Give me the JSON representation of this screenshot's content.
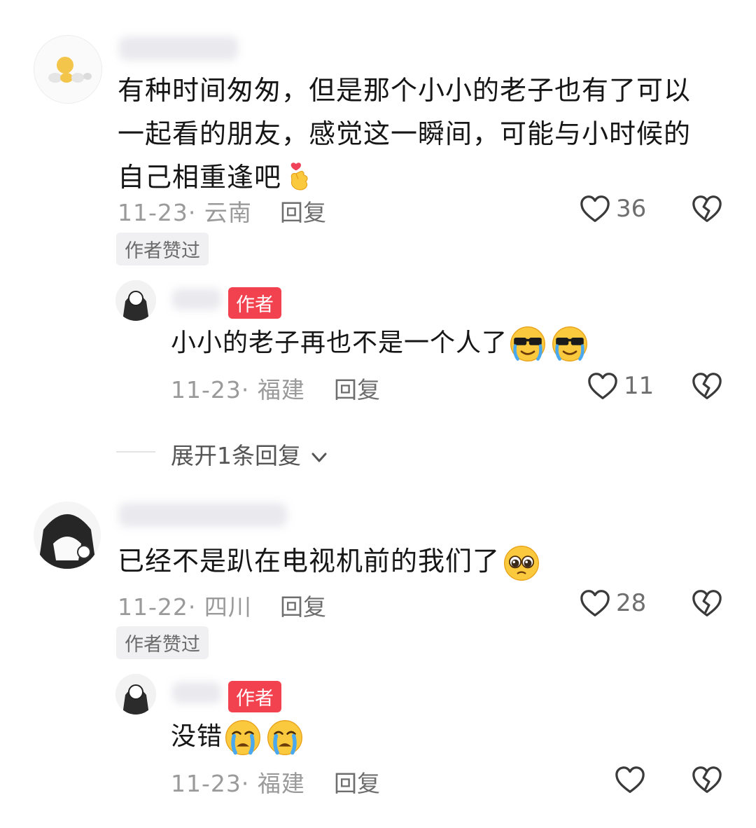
{
  "comments": [
    {
      "text_lines": [
        "有种时间匆匆，但是那个小小的老子也有了可以",
        "一起看的朋友，感觉这一瞬间，可能与小时候的",
        "自己相重逢吧"
      ],
      "date_location": "11-23· 云南",
      "reply_label": "回复",
      "likes": "36",
      "liked_by_author": "作者赞过",
      "reply": {
        "author_badge": "作者",
        "text": "小小的老子再也不是一个人了",
        "date_location": "11-23· 福建",
        "reply_label": "回复",
        "likes": "11"
      },
      "expand_label": "展开1条回复"
    },
    {
      "text": "已经不是趴在电视机前的我们了",
      "date_location": "11-22· 四川",
      "reply_label": "回复",
      "likes": "28",
      "liked_by_author": "作者赞过",
      "reply": {
        "author_badge": "作者",
        "text": "没错",
        "date_location": "11-23· 福建",
        "reply_label": "回复",
        "likes": ""
      }
    }
  ],
  "icons": {
    "like": "heart-outline-icon",
    "dislike": "broken-heart-icon",
    "expand": "chevron-down-icon"
  },
  "colors": {
    "author_badge": "#f2424f",
    "meta_text": "#9a9a9a"
  }
}
